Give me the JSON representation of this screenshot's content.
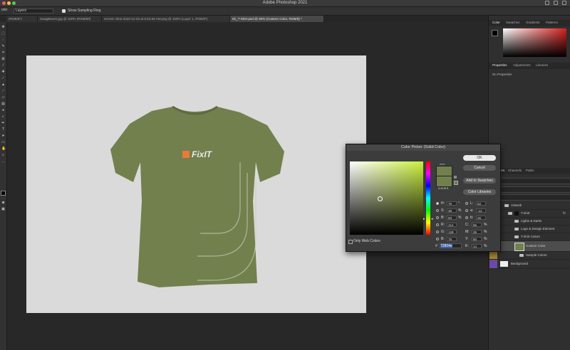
{
  "app": {
    "title": "Adobe Photoshop 2021"
  },
  "options_bar": {
    "sample_select": "olor",
    "layers_select": "Layers",
    "show_sampling_ring": "Show Sampling Ring"
  },
  "tabs": [
    {
      "label": "(RGB/8*)"
    },
    {
      "label": "SwagBoxes.jpg @ 100% (RGB/8#)"
    },
    {
      "label": "Screen Shot 2020-12-04 at 9.53.55 AM.png @ 100% (Layer 1, RGB/8*)"
    },
    {
      "label": "02_T-Shirt.psd @ 50% (Custom Color, RGB/8) *"
    }
  ],
  "canvas": {
    "logo_text": "FixIT",
    "shirt_color": "#72804e",
    "canvas_bg": "#dadada"
  },
  "panels": {
    "color_tabs": [
      "Color",
      "Swatches",
      "Gradients",
      "Patterns"
    ],
    "properties_tabs": [
      "Properties",
      "Adjustments",
      "Libraries"
    ],
    "no_properties": "No Properties",
    "layer_tabs": [
      "ers",
      "Channels",
      "Paths"
    ],
    "layers": [
      {
        "name": "Artwork"
      },
      {
        "name": "T-shirt"
      },
      {
        "name": "Lights & Darks"
      },
      {
        "name": "Logo & Design Element"
      },
      {
        "name": "T-shirt Colors"
      },
      {
        "name": "Custom Color"
      },
      {
        "name": "Sample Colors"
      },
      {
        "name": "Background"
      }
    ]
  },
  "dialog": {
    "title": "Color Picker (Solid Color)",
    "ok": "OK",
    "cancel": "Cancel",
    "add_to_swatches": "Add to Swatches",
    "color_libraries": "Color Libraries",
    "new_label": "new",
    "current_label": "current",
    "only_web_colors": "Only Web Colors",
    "hex_prefix": "#",
    "hex": "72804e",
    "new_color": "#72804e",
    "current_color": "#72804e",
    "fields": {
      "H": {
        "value": "76",
        "unit": "°"
      },
      "S": {
        "value": "39",
        "unit": "%"
      },
      "B": {
        "value": "50",
        "unit": "%"
      },
      "R": {
        "value": "114",
        "unit": ""
      },
      "G": {
        "value": "128",
        "unit": ""
      },
      "Bv": {
        "value": "78",
        "unit": ""
      },
      "L": {
        "value": "52",
        "unit": ""
      },
      "a": {
        "value": "-12",
        "unit": ""
      },
      "b": {
        "value": "26",
        "unit": ""
      },
      "C": {
        "value": "56",
        "unit": "%"
      },
      "M": {
        "value": "35",
        "unit": "%"
      },
      "Y": {
        "value": "80",
        "unit": "%"
      },
      "K": {
        "value": "14",
        "unit": "%"
      }
    },
    "labels": {
      "H": "H:",
      "S": "S:",
      "B": "B:",
      "R": "R:",
      "G": "G:",
      "Bv": "B:",
      "L": "L:",
      "a": "a:",
      "b": "b:",
      "C": "C:",
      "M": "M:",
      "Y": "Y:",
      "K": "K:"
    }
  }
}
